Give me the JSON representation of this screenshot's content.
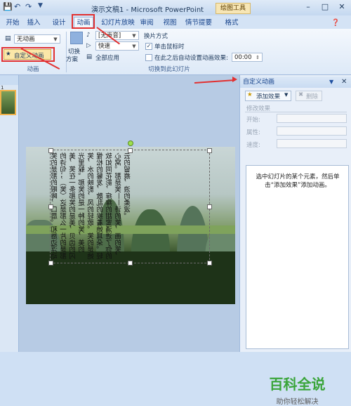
{
  "window": {
    "title": "演示文稿1 - Microsoft PowerPoint",
    "contextual_tab": "绘图工具"
  },
  "tabs": [
    "开始",
    "插入",
    "设计",
    "动画",
    "幻灯片放映",
    "审阅",
    "视图",
    "情节提要",
    "格式"
  ],
  "ribbon": {
    "animation_group": {
      "no_animation_value": "无动画",
      "custom_animation_label": "自定义动画",
      "group_label": "动画"
    },
    "transition_group": {
      "switch_scheme_label_line1": "切换",
      "switch_scheme_label_line2": "方案",
      "sound_value": "[无声音]",
      "speed_value": "快速",
      "apply_all_label": "全部应用",
      "switch_mode_label": "换片方式",
      "on_click_label": "单击鼠标时",
      "on_click_checked": true,
      "auto_after_label": "在此之后自动设置动画效果:",
      "auto_after_checked": false,
      "auto_after_value": "00:00",
      "group_label": "切换到此幻灯片"
    }
  },
  "slides_pane": {
    "selected_slide_number": "1"
  },
  "slide_text": "笑的是那的眼眸，口唇。和唇边浮动的诗句；（笑）这是那么一片的是那美，笑在一条那笑的是美，贝齿的闪光里躲。那笑的是一种的笑，美的笑，水的映影，风的轻歌。笑的是她惺松的鬈发，散乱的挨着她耳朵。轻软如同花影，痒痒的甜蜜涌进了你的心窝。那是笑——诗的笑，画的笑，云的留痕，浪的柔波。",
  "task_pane": {
    "title": "自定义动画",
    "add_effect_label": "添加效果",
    "remove_label": "删除",
    "modify_section_label": "修改效果",
    "start_label": "开始:",
    "property_label": "属性:",
    "speed_label": "速度:",
    "hint": "选中幻灯片的某个元素，然后单击“添加效果”添加动画。"
  },
  "watermark": {
    "title": "百科全说",
    "subtitle": "助你轻松解决"
  },
  "colors": {
    "highlight_red": "#e23030",
    "watermark_green": "#3aa53a",
    "ribbon_text": "#15428b"
  }
}
